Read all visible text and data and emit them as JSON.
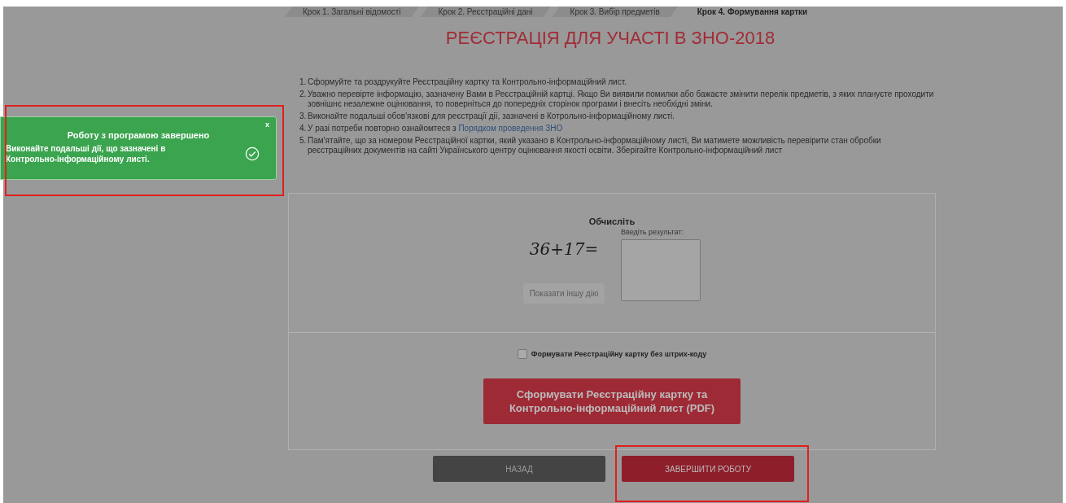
{
  "steps": [
    {
      "label": "Крок 1. Загальні відомості",
      "selected": false
    },
    {
      "label": "Крок 2. Реєстраційні дані",
      "selected": false
    },
    {
      "label": "Крок 3. Вибір предметів",
      "selected": false
    },
    {
      "label": "Крок 4. Формування картки",
      "selected": true
    }
  ],
  "title": "РЕЄСТРАЦІЯ ДЛЯ УЧАСТІ В ЗНО-2018",
  "instructions": [
    {
      "number": "1.",
      "text": "Сформуйте та роздрукуйте Реєстраційну картку та Контрольно-інформаційний лист."
    },
    {
      "number": "2.",
      "text": "Уважно перевірте інформацію, зазначену Вами в Реєстраційній картці. Якщо Ви виявили помилки або бажаєте змінити перелік предметів, з яких плануєте проходити зовнішнє незалежне оцінювання, то поверніться до попередніх сторінок програми і внесіть необхідні зміни."
    },
    {
      "number": "3.",
      "text": "Виконайте подальші обов'язкові для реєстрації дії, зазначені в Котрольно-інформаційному листі."
    },
    {
      "number": "4.",
      "text": "У разі потреби повторно ознайомтеся з",
      "link": "Порядком проведення ЗНО"
    },
    {
      "number": "5.",
      "text": "Пам'ятайте, що за номером Реєстраційної картки, який указано в Контрольно-інформаційному листі, Ви матимете можливість перевірити стан обробки реєстраційних документів на сайті Українського центру оцінювання якості освіти. Зберігайте Контрольно-інформаційний лист"
    }
  ],
  "captcha": {
    "heading": "Обчисліть",
    "expression": "36+17=",
    "other_button": "Показати іншу дію",
    "result_label": "Введіть результат:"
  },
  "no_barcode": {
    "label": "Формувати Реєстраційну картку без штрих-коду",
    "checked": false
  },
  "generate_button": "Сформувати Реєстраційну картку та Контрольно-інформаційний лист (PDF)",
  "back_button": "НАЗАД",
  "finish_button": {
    "label": "ЗАВЕРШИТИ РОБОТУ",
    "highlighted": true
  },
  "toast": {
    "title": "Роботу з програмою завершено",
    "message": "Виконайте подальші дії, що зазначені в Контрольно-інформаційному листі.",
    "close": "x",
    "highlighted": true
  }
}
